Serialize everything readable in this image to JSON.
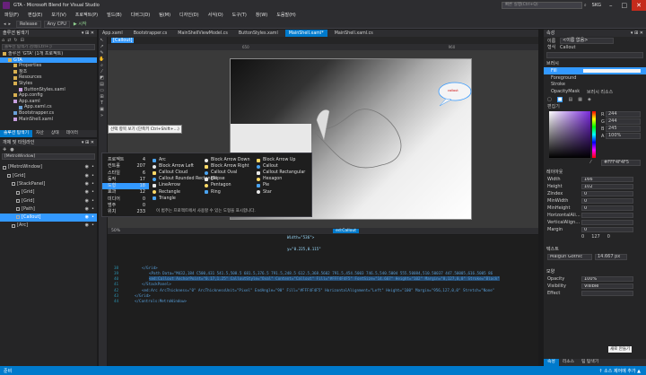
{
  "window": {
    "title": "GTA - Microsoft Blend for Visual Studio",
    "search_placeholder": "빠른 실행(Ctrl+Q)",
    "user": "SKG"
  },
  "menu": [
    "파일(F)",
    "편집(E)",
    "보기(V)",
    "프로젝트(P)",
    "빌드(B)",
    "디버그(D)",
    "팀(M)",
    "디자인(D)",
    "서식(O)",
    "도구(T)",
    "창(W)",
    "도움말(H)"
  ],
  "toolbar": {
    "config": "Release",
    "platform": "Any CPU",
    "start": "▶ 시작"
  },
  "solution_explorer": {
    "title": "솔루션 탐색기",
    "search_placeholder": "솔루션 탐색기 검색(Ctrl+;)",
    "items": [
      {
        "label": "솔루션 'GTA' (1개 프로젝트)",
        "indent": 0
      },
      {
        "label": "GTA",
        "indent": 1,
        "selected": true
      },
      {
        "label": "Properties",
        "indent": 2
      },
      {
        "label": "참조",
        "indent": 2
      },
      {
        "label": "Resources",
        "indent": 2
      },
      {
        "label": "Styles",
        "indent": 2
      },
      {
        "label": "ButtonStyles.xaml",
        "indent": 3
      },
      {
        "label": "App.config",
        "indent": 2
      },
      {
        "label": "App.xaml",
        "indent": 2
      },
      {
        "label": "App.xaml.cs",
        "indent": 3
      },
      {
        "label": "Bootstrapper.cs",
        "indent": 2
      },
      {
        "label": "MainShell.xaml",
        "indent": 2
      }
    ],
    "tabs": [
      "솔루션 탐색기",
      "자산",
      "상태",
      "데이터"
    ]
  },
  "objects_panel": {
    "title": "개체 및 타임라인",
    "root": "[MetroWindow]",
    "items": [
      {
        "label": "[MetroWindow]",
        "indent": 0
      },
      {
        "label": "[Grid]",
        "indent": 1
      },
      {
        "label": "[StackPanel]",
        "indent": 2
      },
      {
        "label": "[Grid]",
        "indent": 3
      },
      {
        "label": "[Grid]",
        "indent": 3
      },
      {
        "label": "[Path]",
        "indent": 3
      },
      {
        "label": "[Callout]",
        "indent": 3,
        "selected": true
      },
      {
        "label": "[Arc]",
        "indent": 2
      }
    ]
  },
  "doc_tabs": [
    "App.xaml",
    "Bootstrapper.cs",
    "MainShellViewModel.cs",
    "ButtonStyles.xaml",
    "MainShell.xaml*",
    "MainShell.xaml.cs"
  ],
  "active_doc_tab": "MainShell.xaml*",
  "breadcrumb": "[Callout]",
  "ruler": {
    "left": "650",
    "right": "960"
  },
  "canvas": {
    "callout_text": "callout",
    "zoom": "50%"
  },
  "tooltip": "선택 항목 보기 (단축키 Ctrl+Shift+…)",
  "assets": {
    "categories": [
      {
        "label": "프로젝트",
        "count": "4"
      },
      {
        "label": "컨트롤",
        "count": "207"
      },
      {
        "label": "스타일",
        "count": "6"
      },
      {
        "label": "동작",
        "count": "17"
      },
      {
        "label": "도형",
        "count": "18",
        "selected": true
      },
      {
        "label": "효과",
        "count": "12"
      },
      {
        "label": "미디어",
        "count": "0"
      },
      {
        "label": "범주",
        "count": "0"
      },
      {
        "label": "위치",
        "count": "233"
      }
    ],
    "shapes": [
      [
        "Arc",
        "Block Arrow Down",
        "Block Arrow Up"
      ],
      [
        "Block Arrow Left",
        "Block Arrow Right",
        "Callout"
      ],
      [
        "Callout Cloud",
        "Callout Oval",
        "Callout Rectangular"
      ],
      [
        "Callout Rounded Rectangle",
        "Ellipse",
        "Hexagon"
      ],
      [
        "LineArrow",
        "Pentagon",
        "Pie"
      ],
      [
        "Rectangle",
        "Ring",
        "Star"
      ],
      [
        "Triangle",
        "",
        ""
      ]
    ],
    "footer": "이 범주는 프로젝트에서 사용할 수 있는 도형을 표시합니다."
  },
  "xaml_panel": {
    "tab": "ed:Callout",
    "lines": [
      {
        "n": "38",
        "text": "</Grid>"
      },
      {
        "n": "39",
        "text": "<Path Data=\"M432,184 C500,431 541.5,508.5 681.5,376.5 791.5,248.5 612.5,368.5602 791.5,454.5003 746.5,540.5004 555.50084,510.50037 447.50005,616.5005 86"
      },
      {
        "n": "40",
        "text": "<ed:Callout AnchorPoint=\"0.17,1.25\" CalloutStyle=\"Oval\" Content=\"Callout\" Fill=\"#FFF4F4F5\" FontSize=\"14.667\" Height=\"102\" Margin=\"0,127,0,0\" Stroke=\"Black\""
      },
      {
        "n": "41",
        "text": "</StackPanel>"
      },
      {
        "n": "42",
        "text": "<ed:Arc ArcThickness=\"0\" ArcThicknessUnit=\"Pixel\" EndAngle=\"90\" Fill=\"#FFF4F4F5\" HorizontalAlignment=\"Left\" Height=\"100\" Margin=\"956,127,0,0\" Stretch=\"None\""
      },
      {
        "n": "43",
        "text": "</Grid>"
      },
      {
        "n": "44",
        "text": "</Controls:MetroWindow>"
      }
    ],
    "pre_lines": [
      "Width=\"536\">",
      "y=\"0.225,0.115\""
    ]
  },
  "properties": {
    "title": "속성",
    "name_label": "이름",
    "name_value": "<이름 없음>",
    "type_label": "형식",
    "type_value": "Callout",
    "sections": {
      "brush": "브러시",
      "layout": "레이아웃",
      "text": "텍스트",
      "appearance": "모양"
    },
    "brush_items": [
      "Fill",
      "Foreground",
      "Stroke",
      "OpacityMask"
    ],
    "brush_resources": "브러시 리소스",
    "editor_label": "편집기",
    "color": {
      "r": "244",
      "g": "244",
      "b": "245",
      "a": "100%",
      "hex": "#FFF4F4F5"
    },
    "layout": [
      {
        "label": "Width",
        "value": "166"
      },
      {
        "label": "Height",
        "value": "102"
      },
      {
        "label": "ZIndex",
        "value": "0"
      },
      {
        "label": "MinWidth",
        "value": "0"
      },
      {
        "label": "MinHeight",
        "value": "0"
      },
      {
        "label": "HorizontalAli…",
        "value": ""
      },
      {
        "label": "VerticalAlign…",
        "value": ""
      },
      {
        "label": "Margin",
        "value": "0"
      }
    ],
    "margin_vals": [
      "0",
      "127",
      "0"
    ],
    "font": {
      "family": "Malgun Gothic",
      "size": "14.667 px"
    },
    "appearance": [
      {
        "label": "Opacity",
        "value": "100%"
      },
      {
        "label": "Visibility",
        "value": "Visible"
      },
      {
        "label": "Effect",
        "value": ""
      }
    ],
    "new_button": "새로 만들기",
    "footer_tabs": [
      "속성",
      "리소스",
      "팀 탐색기"
    ]
  },
  "status": {
    "left": "준비",
    "right": "↑ 소스 제어에 추가 ▲"
  },
  "colors": {
    "accent": "#007acc",
    "status_bar": "#007acc",
    "selection": "#3399ff"
  }
}
